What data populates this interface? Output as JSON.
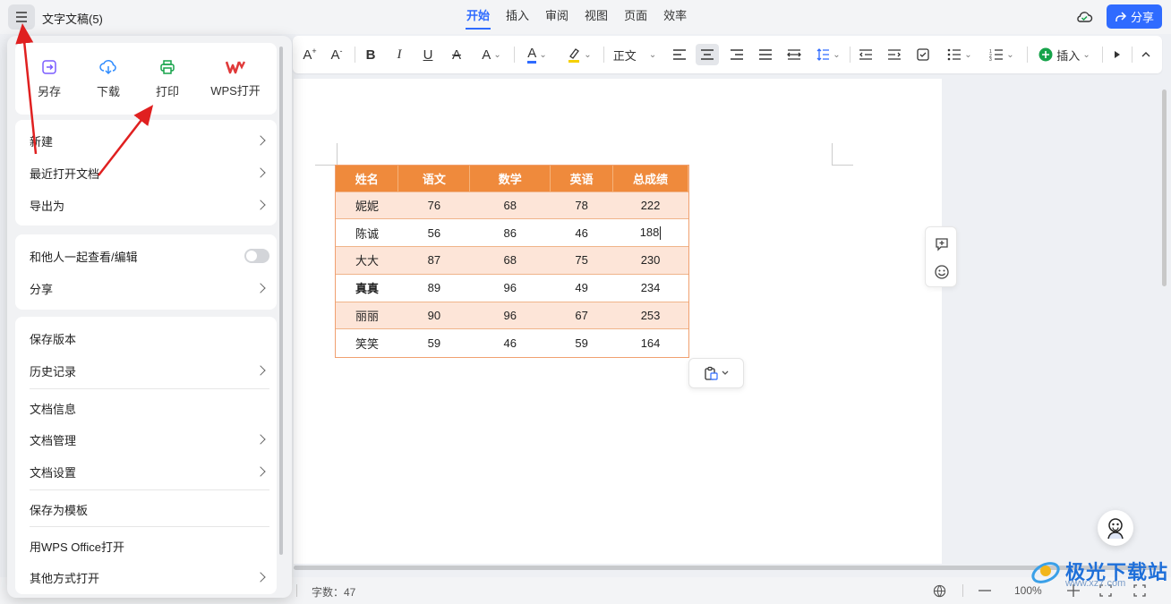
{
  "header": {
    "doc_title": "文字文稿(5)",
    "tabs": [
      {
        "label": "开始",
        "active": true
      },
      {
        "label": "插入",
        "active": false
      },
      {
        "label": "审阅",
        "active": false
      },
      {
        "label": "视图",
        "active": false
      },
      {
        "label": "页面",
        "active": false
      },
      {
        "label": "效率",
        "active": false
      }
    ],
    "share_label": "分享"
  },
  "toolbar": {
    "paragraph_style": "正文",
    "insert_label": "插入",
    "accent_color": "#2f6bff",
    "font_color_bar": "#2f6bff",
    "highlight_color_bar": "#f5d000"
  },
  "menu": {
    "quick_actions": [
      {
        "label": "另存",
        "icon": "save-as-icon",
        "color": "#7a5cff"
      },
      {
        "label": "下载",
        "icon": "download-icon",
        "color": "#2f8cff"
      },
      {
        "label": "打印",
        "icon": "print-icon",
        "color": "#16a34a"
      },
      {
        "label": "WPS打开",
        "icon": "wps-logo-icon",
        "color": "#e03a3a"
      }
    ],
    "group1": [
      {
        "label": "新建",
        "has_arrow": true
      },
      {
        "label": "最近打开文档",
        "has_arrow": true
      },
      {
        "label": "导出为",
        "has_arrow": true
      }
    ],
    "group2": [
      {
        "label": "和他人一起查看/编辑",
        "toggle": false
      },
      {
        "label": "分享",
        "has_arrow": true
      }
    ],
    "group3": [
      {
        "label": "保存版本",
        "has_arrow": false
      },
      {
        "label": "历史记录",
        "has_arrow": true
      },
      {
        "label": "文档信息",
        "has_arrow": false
      },
      {
        "label": "文档管理",
        "has_arrow": true
      },
      {
        "label": "文档设置",
        "has_arrow": true
      },
      {
        "label": "保存为模板",
        "has_arrow": false
      },
      {
        "label": "用WPS Office打开",
        "has_arrow": false
      },
      {
        "label": "其他方式打开",
        "has_arrow": true
      }
    ]
  },
  "table": {
    "headers": [
      "姓名",
      "语文",
      "数学",
      "英语",
      "总成绩"
    ],
    "rows": [
      [
        "妮妮",
        "76",
        "68",
        "78",
        "222"
      ],
      [
        "陈诚",
        "56",
        "86",
        "46",
        "188"
      ],
      [
        "大大",
        "87",
        "68",
        "75",
        "230"
      ],
      [
        "真真",
        "89",
        "96",
        "49",
        "234"
      ],
      [
        "丽丽",
        "90",
        "96",
        "67",
        "253"
      ],
      [
        "笑笑",
        "59",
        "46",
        "59",
        "164"
      ]
    ],
    "header_color": "#ef8a3c",
    "stripe_color": "#fde5d8"
  },
  "status": {
    "word_count": "字数：47",
    "zoom": "100%"
  },
  "watermark": {
    "text": "极光下载站",
    "url": "www.xz7.com"
  },
  "annotation_color": "#e02020"
}
